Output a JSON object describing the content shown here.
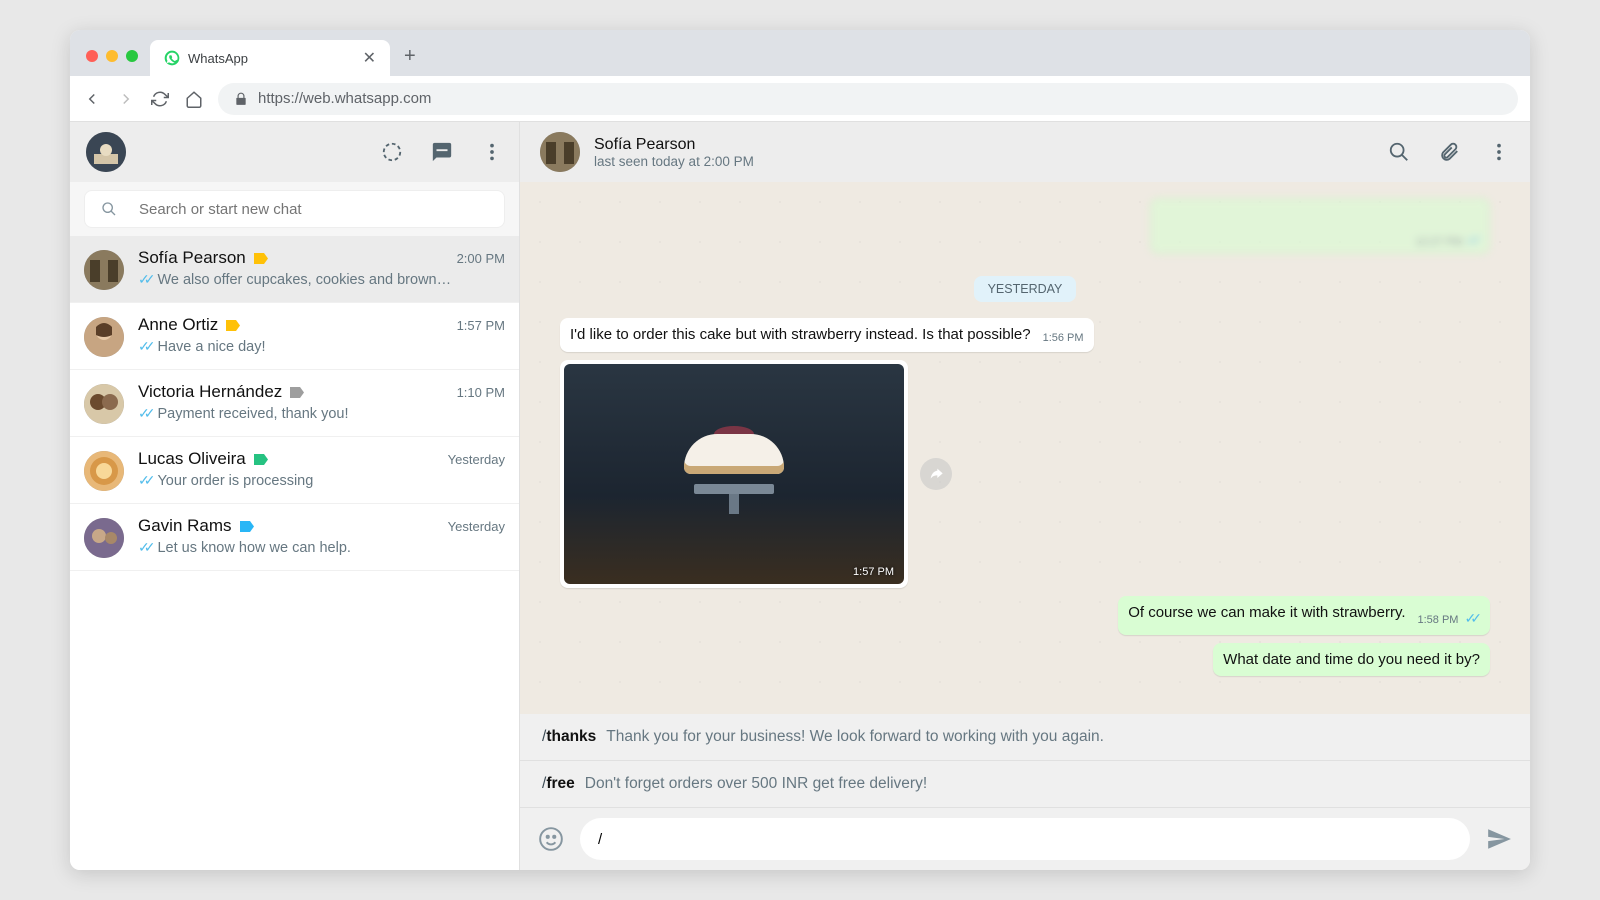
{
  "browser": {
    "tab_title": "WhatsApp",
    "url": "https://web.whatsapp.com"
  },
  "sidebar": {
    "search_placeholder": "Search or start new chat",
    "chats": [
      {
        "name": "Sofía Pearson",
        "time": "2:00 PM",
        "preview": "We also offer cupcakes, cookies and brown…",
        "label_color": "#ffc107",
        "active": true
      },
      {
        "name": "Anne Ortiz",
        "time": "1:57 PM",
        "preview": "Have a nice day!",
        "label_color": "#ffc107",
        "active": false
      },
      {
        "name": "Victoria Hernández",
        "time": "1:10 PM",
        "preview": "Payment received, thank you!",
        "label_color": "#9e9e9e",
        "active": false
      },
      {
        "name": "Lucas Oliveira",
        "time": "Yesterday",
        "preview": "Your order is processing",
        "label_color": "#26c281",
        "active": false
      },
      {
        "name": "Gavin Rams",
        "time": "Yesterday",
        "preview": "Let us know how we can help.",
        "label_color": "#29b6f6",
        "active": false
      }
    ]
  },
  "header": {
    "name": "Sofía Pearson",
    "status": "last seen today at 2:00 PM"
  },
  "conversation": {
    "prev_out_time": "12:27 PM",
    "day_divider": "YESTERDAY",
    "msg_in_1": "I'd like to order this cake but with strawberry instead. Is that possible?",
    "msg_in_1_time": "1:56 PM",
    "img_time": "1:57 PM",
    "msg_out_1": "Of course we can make it with strawberry.",
    "msg_out_1_time": "1:58 PM",
    "msg_out_2": "What date and time do you need it by?"
  },
  "quick_replies": [
    {
      "prefix": "/",
      "cmd": "thanks",
      "desc": "Thank you for your business! We look forward to working with you again."
    },
    {
      "prefix": "/",
      "cmd": "free",
      "desc": "Don't forget orders over 500 INR get free delivery!"
    }
  ],
  "compose": {
    "value": "/"
  }
}
